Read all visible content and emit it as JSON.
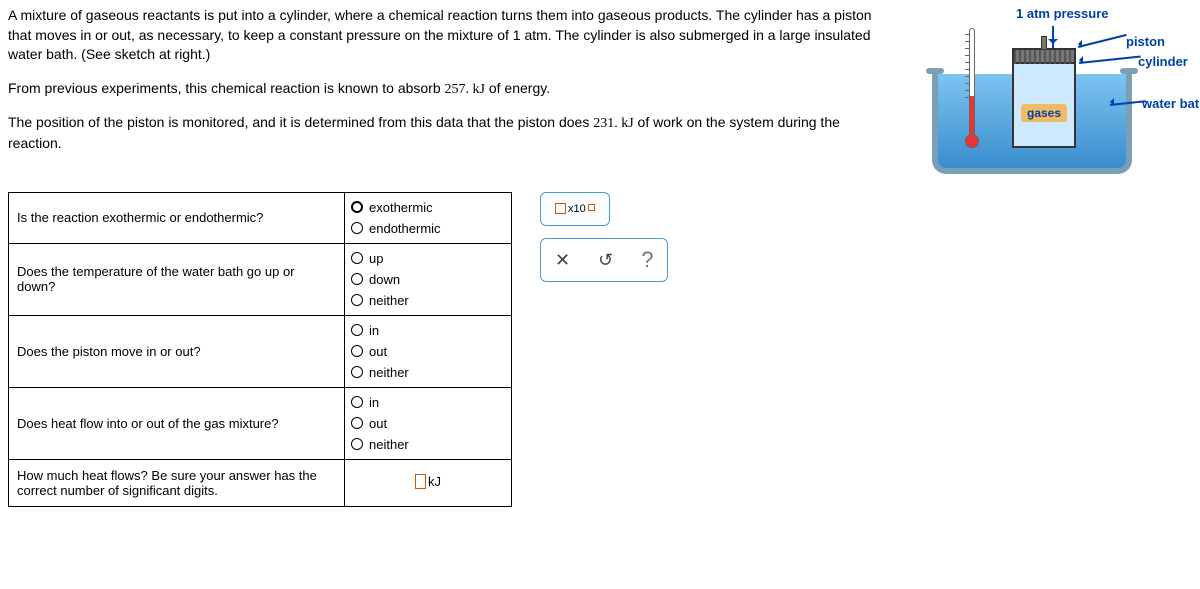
{
  "problem": {
    "p1": "A mixture of gaseous reactants is put into a cylinder, where a chemical reaction turns them into gaseous products. The cylinder has a piston that moves in or out, as necessary, to keep a constant pressure on the mixture of 1 atm. The cylinder is also submerged in a large insulated water bath. (See sketch at right.)",
    "p2_a": "From previous experiments, this chemical reaction is known to absorb ",
    "p2_val": "257. kJ",
    "p2_b": " of energy.",
    "p3_a": "The position of the piston is monitored, and it is determined from this data that the piston does ",
    "p3_val": "231. kJ",
    "p3_b": " of work on the system during the reaction."
  },
  "questions": {
    "q1": {
      "text": "Is the reaction exothermic or endothermic?",
      "options": [
        "exothermic",
        "endothermic"
      ]
    },
    "q2": {
      "text": "Does the temperature of the water bath go up or down?",
      "options": [
        "up",
        "down",
        "neither"
      ]
    },
    "q3": {
      "text": "Does the piston move in or out?",
      "options": [
        "in",
        "out",
        "neither"
      ]
    },
    "q4": {
      "text": "Does heat flow into or out of the gas mixture?",
      "options": [
        "in",
        "out",
        "neither"
      ]
    },
    "q5": {
      "text": "How much heat flows? Be sure your answer has the correct number of significant digits.",
      "unit": "kJ"
    }
  },
  "toolbox": {
    "x10_label": "x10",
    "close": "✕",
    "reset": "↺",
    "help": "?"
  },
  "diagram": {
    "pressure": "1 atm pressure",
    "piston": "piston",
    "cylinder": "cylinder",
    "water_bath": "water bath",
    "gases": "gases"
  }
}
